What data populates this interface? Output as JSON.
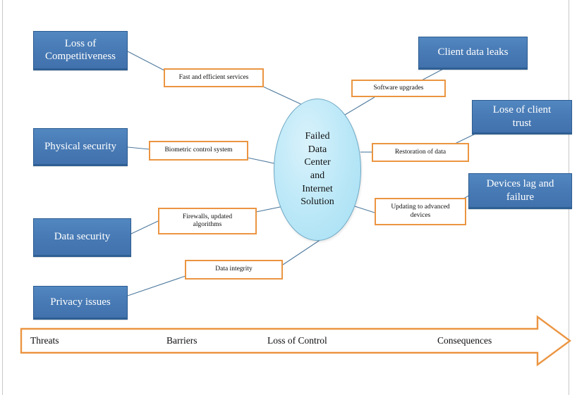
{
  "diagram": {
    "title": "Failed Data Center and Internet Solution",
    "colors": {
      "blue_box_fill": "#4779b4",
      "blue_box_border": "#2c5d92",
      "orange_box_border": "#eb9542",
      "ellipse_fill": "#bfe9f8",
      "ellipse_border": "#6fa8c4",
      "connector_line": "#4f7a9e",
      "arrow_band_border": "#eb9542",
      "page_rule": "#c8c8c8"
    },
    "center_node": {
      "label": "Failed\nData\nCenter\nand\nInternet\nSolution",
      "lines": [
        "Failed",
        "Data",
        "Center",
        "and",
        "Internet",
        "Solution"
      ]
    },
    "threat_boxes": [
      {
        "id": "loss-of-competitiveness",
        "label": "Loss of\nCompetitiveness"
      },
      {
        "id": "physical-security",
        "label": "Physical security"
      },
      {
        "id": "data-security",
        "label": "Data security"
      },
      {
        "id": "privacy-issues",
        "label": "Privacy issues"
      }
    ],
    "consequence_boxes": [
      {
        "id": "client-data-leaks",
        "label": "Client data leaks"
      },
      {
        "id": "lose-of-client-trust",
        "label": "Lose of client\ntrust"
      },
      {
        "id": "devices-lag-failure",
        "label": "Devices lag and\nfailure"
      }
    ],
    "barrier_boxes": [
      {
        "id": "fast-and-efficient-services",
        "label": "Fast and efficient services"
      },
      {
        "id": "biometric-control-system",
        "label": "Biometric control system"
      },
      {
        "id": "firewalls-updated-algorithms",
        "label": "Firewalls, updated\nalgorithms"
      },
      {
        "id": "data-integrity",
        "label": "Data integrity"
      },
      {
        "id": "software-upgrades",
        "label": "Software upgrades"
      },
      {
        "id": "restoration-of-data",
        "label": "Restoration of data"
      },
      {
        "id": "updating-to-advanced-devices",
        "label": "Updating to advanced\ndevices"
      }
    ],
    "arrow_band": {
      "labels": [
        {
          "id": "threats",
          "label": "Threats"
        },
        {
          "id": "barriers",
          "label": "Barriers"
        },
        {
          "id": "loss-of-control",
          "label": "Loss of Control"
        },
        {
          "id": "consequences",
          "label": "Consequences"
        }
      ]
    }
  }
}
